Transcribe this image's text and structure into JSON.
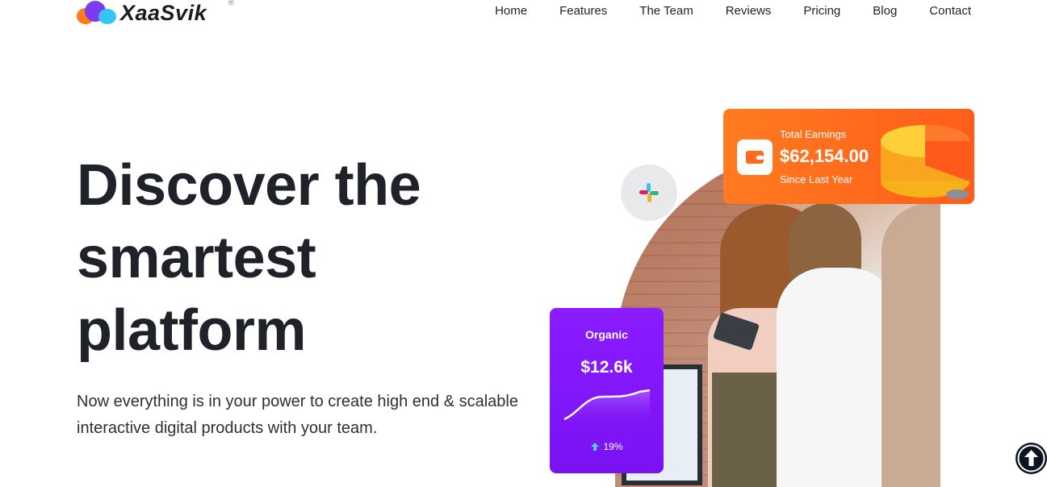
{
  "brand": {
    "name": "XaaSvik",
    "mark": "®"
  },
  "nav": {
    "items": [
      "Home",
      "Features",
      "The Team",
      "Reviews",
      "Pricing",
      "Blog",
      "Contact"
    ]
  },
  "hero": {
    "title": "Discover the smartest platform",
    "subtitle": "Now everything is in your power to create high end & scalable interactive digital products with your team."
  },
  "earnings_card": {
    "label": "Total Earnings",
    "value": "$62,154.00",
    "since": "Since Last Year",
    "icon": "wallet-icon",
    "color": "#ff6a1c"
  },
  "organic_card": {
    "label": "Organic",
    "value": "$12.6k",
    "percent": "19%",
    "trend_icon": "arrow-up-icon",
    "color": "#7d14f5"
  },
  "floating_badge": {
    "icon": "slack-icon"
  },
  "scroll_button": {
    "icon": "arrow-up-circle-icon"
  }
}
